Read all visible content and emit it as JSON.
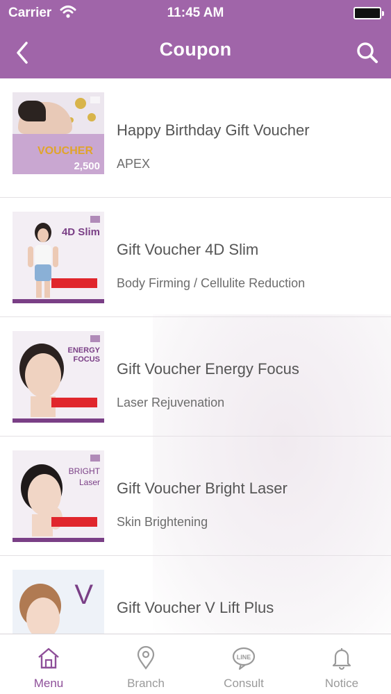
{
  "status_bar": {
    "carrier": "Carrier",
    "time": "11:45 AM"
  },
  "navbar": {
    "title": "Coupon",
    "back_icon": "chevron-left-icon",
    "search_icon": "search-icon"
  },
  "colors": {
    "accent": "#a065a9",
    "active_tab": "#8e4f99",
    "inactive_tab": "#9a9a9a"
  },
  "coupons": [
    {
      "title": "Happy Birthday Gift Voucher",
      "subtitle": "APEX",
      "thumb": {
        "headline": "",
        "voucher": "VOUCHER",
        "amount": "2,500"
      }
    },
    {
      "title": "Gift Voucher 4D Slim",
      "subtitle": "Body Firming / Cellulite Reduction",
      "thumb": {
        "headline": "4D Slim"
      }
    },
    {
      "title": "Gift Voucher Energy Focus",
      "subtitle": "Laser Rejuvenation",
      "thumb": {
        "headline": "ENERGY FOCUS"
      }
    },
    {
      "title": "Gift Voucher Bright Laser",
      "subtitle": "Skin Brightening",
      "thumb": {
        "headline": "BRIGHT Laser"
      }
    },
    {
      "title": "Gift Voucher V Lift Plus",
      "subtitle": "",
      "thumb": {
        "headline": "V"
      }
    }
  ],
  "tabs": [
    {
      "label": "Menu",
      "icon": "home-icon",
      "active": true
    },
    {
      "label": "Branch",
      "icon": "location-pin-icon",
      "active": false
    },
    {
      "label": "Consult",
      "icon": "line-chat-icon",
      "active": false
    },
    {
      "label": "Notice",
      "icon": "bell-icon",
      "active": false
    }
  ]
}
